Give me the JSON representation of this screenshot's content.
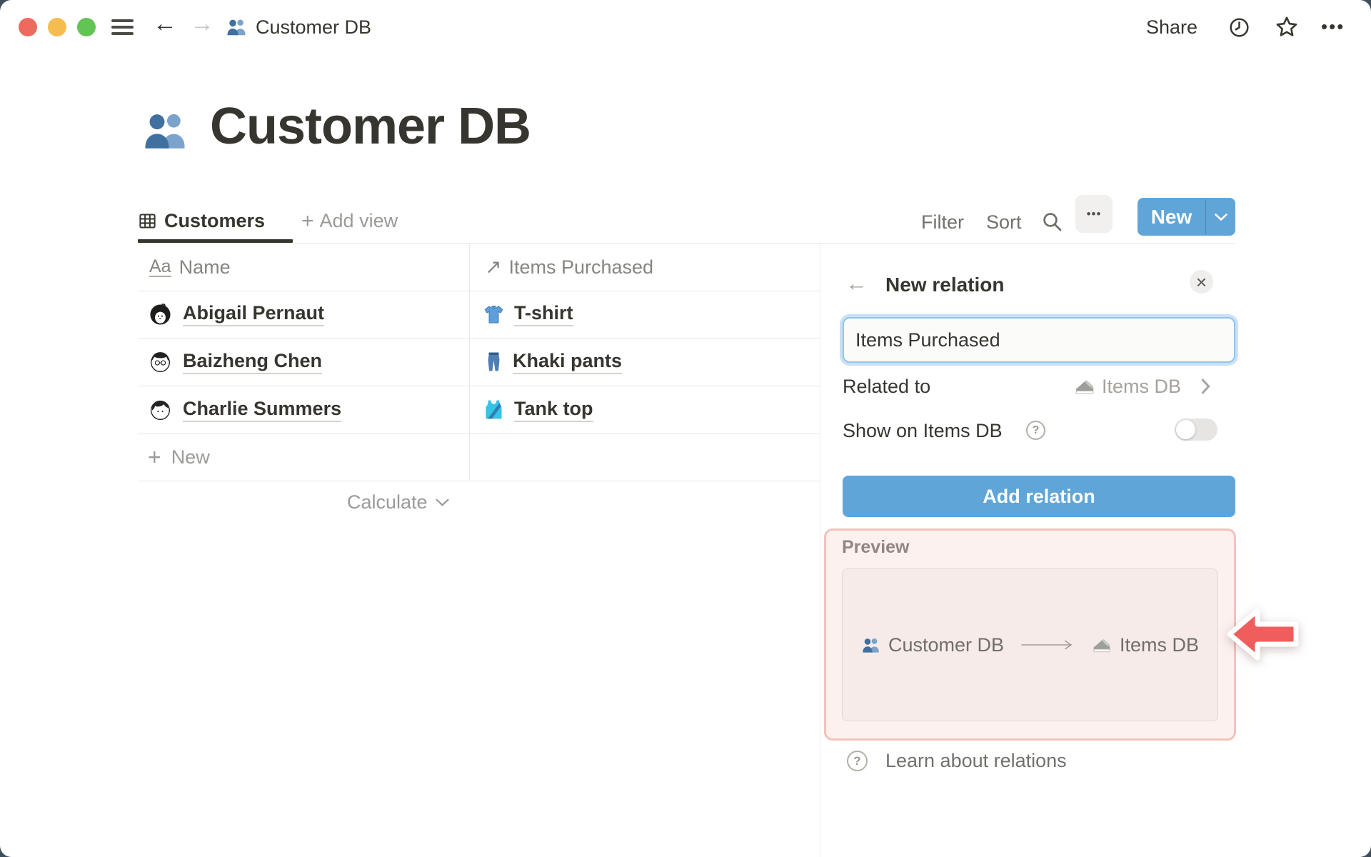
{
  "titlebar": {
    "title": "Customer DB",
    "share_label": "Share"
  },
  "page": {
    "title": "Customer DB"
  },
  "view_tabs": {
    "active_tab": "Customers",
    "add_view_label": "Add view"
  },
  "toolbar": {
    "filter_label": "Filter",
    "sort_label": "Sort",
    "new_label": "New"
  },
  "table": {
    "columns": [
      {
        "label": "Name"
      },
      {
        "label": "Items Purchased"
      }
    ],
    "rows": [
      {
        "name": "Abigail Pernaut",
        "item": "T-shirt"
      },
      {
        "name": "Baizheng Chen",
        "item": "Khaki pants"
      },
      {
        "name": "Charlie Summers",
        "item": "Tank top"
      }
    ],
    "new_row_label": "New",
    "calculate_label": "Calculate"
  },
  "panel": {
    "title": "New relation",
    "name_input_value": "Items Purchased",
    "related_to_label": "Related to",
    "related_to_value": "Items DB",
    "show_on_label": "Show on Items DB",
    "add_button_label": "Add relation",
    "preview_label": "Preview",
    "preview_source": "Customer DB",
    "preview_target": "Items DB",
    "learn_label": "Learn about relations"
  },
  "icons": {
    "back_arrow": "←",
    "forward_arrow": "→",
    "ellipsis": "•••",
    "title_property": "Aa",
    "relation_arrow": "↗",
    "plus": "+",
    "close": "×",
    "question_mark": "?"
  },
  "colors": {
    "accent_blue": "#5fa5d8",
    "annotation_red": "#ef5e5c",
    "highlight_pink_bg": "#fcf1ef",
    "highlight_pink_border": "#f3c2bc",
    "window_backdrop": "#3d4f5a"
  }
}
